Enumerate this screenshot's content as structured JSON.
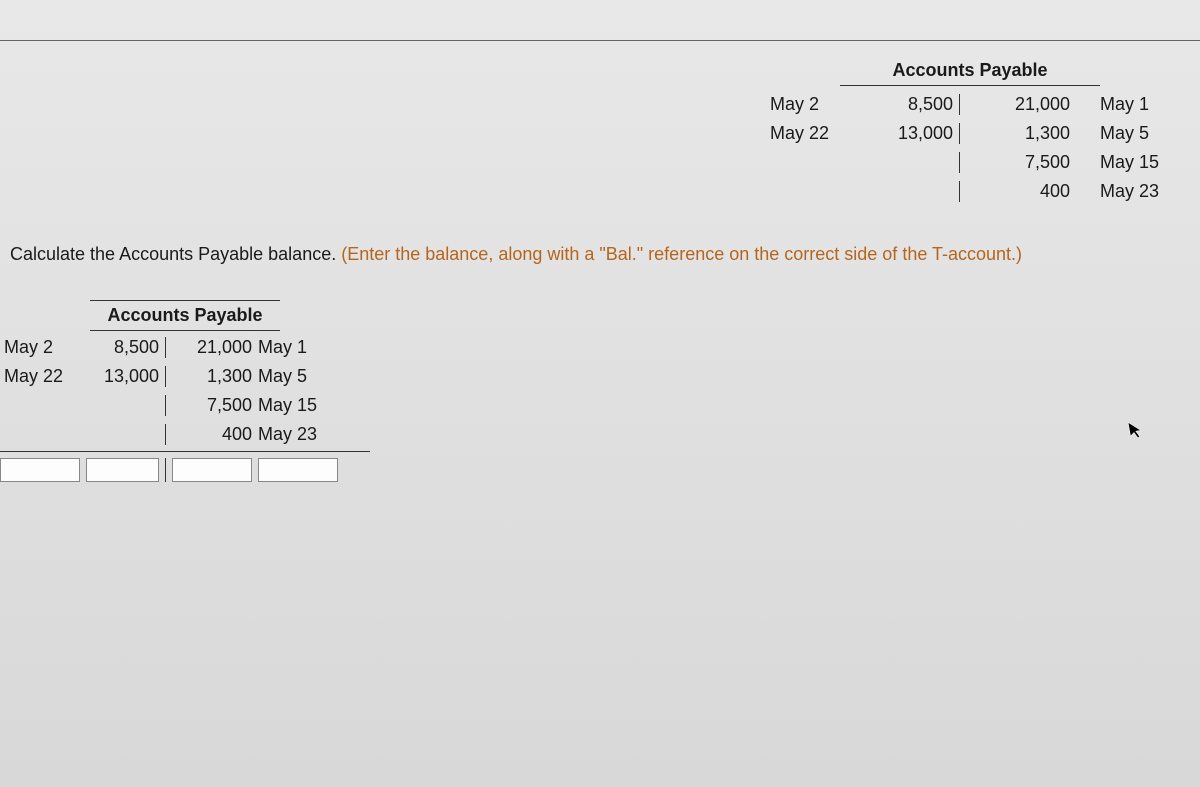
{
  "reference": {
    "title": "Accounts Payable",
    "debit_rows": [
      {
        "date": "May 2",
        "amount": "8,500"
      },
      {
        "date": "May 22",
        "amount": "13,000"
      },
      {
        "date": "",
        "amount": ""
      },
      {
        "date": "",
        "amount": ""
      }
    ],
    "credit_rows": [
      {
        "date": "May 1",
        "amount": "21,000"
      },
      {
        "date": "May 5",
        "amount": "1,300"
      },
      {
        "date": "May 15",
        "amount": "7,500"
      },
      {
        "date": "May 23",
        "amount": "400"
      }
    ]
  },
  "instruction": {
    "main": "Calculate the Accounts Payable balance. ",
    "hint": "(Enter the balance, along with a \"Bal.\" reference on the correct side of the T-account.)"
  },
  "entry": {
    "title": "Accounts Payable",
    "debit_rows": [
      {
        "date": "May 2",
        "amount": "8,500"
      },
      {
        "date": "May 22",
        "amount": "13,000"
      },
      {
        "date": "",
        "amount": ""
      },
      {
        "date": "",
        "amount": ""
      }
    ],
    "credit_rows": [
      {
        "date": "May 1",
        "amount": "21,000"
      },
      {
        "date": "May 5",
        "amount": "1,300"
      },
      {
        "date": "May 15",
        "amount": "7,500"
      },
      {
        "date": "May 23",
        "amount": "400"
      }
    ],
    "inputs": {
      "debit_date": "",
      "debit_amount": "",
      "credit_amount": "",
      "credit_date": ""
    }
  }
}
